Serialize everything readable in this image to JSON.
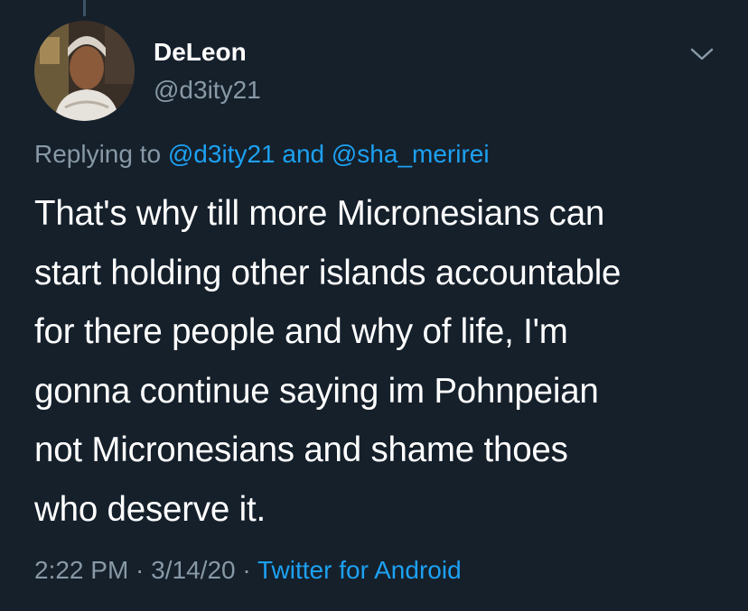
{
  "tweet": {
    "display_name": "DeLeon",
    "handle": "@d3ity21",
    "menu_icon": "chevron-down-icon",
    "replying": {
      "prefix": "Replying to ",
      "mention_1": "@d3ity21",
      "joiner": " and ",
      "mention_2": "@sha_merirei"
    },
    "body_lines": [
      "That's why till more Micronesians can",
      "start holding other islands accountable",
      "for there people and why of life, I'm",
      "gonna continue saying im Pohnpeian",
      "not Micronesians and shame thoes",
      "who deserve it."
    ],
    "time": "2:22 PM",
    "separator": " · ",
    "date": "3/14/20",
    "source": "Twitter for Android"
  },
  "colors": {
    "background": "#15202b",
    "primary_text": "#ffffff",
    "secondary_text": "#8899a6",
    "link": "#1da1f2"
  }
}
